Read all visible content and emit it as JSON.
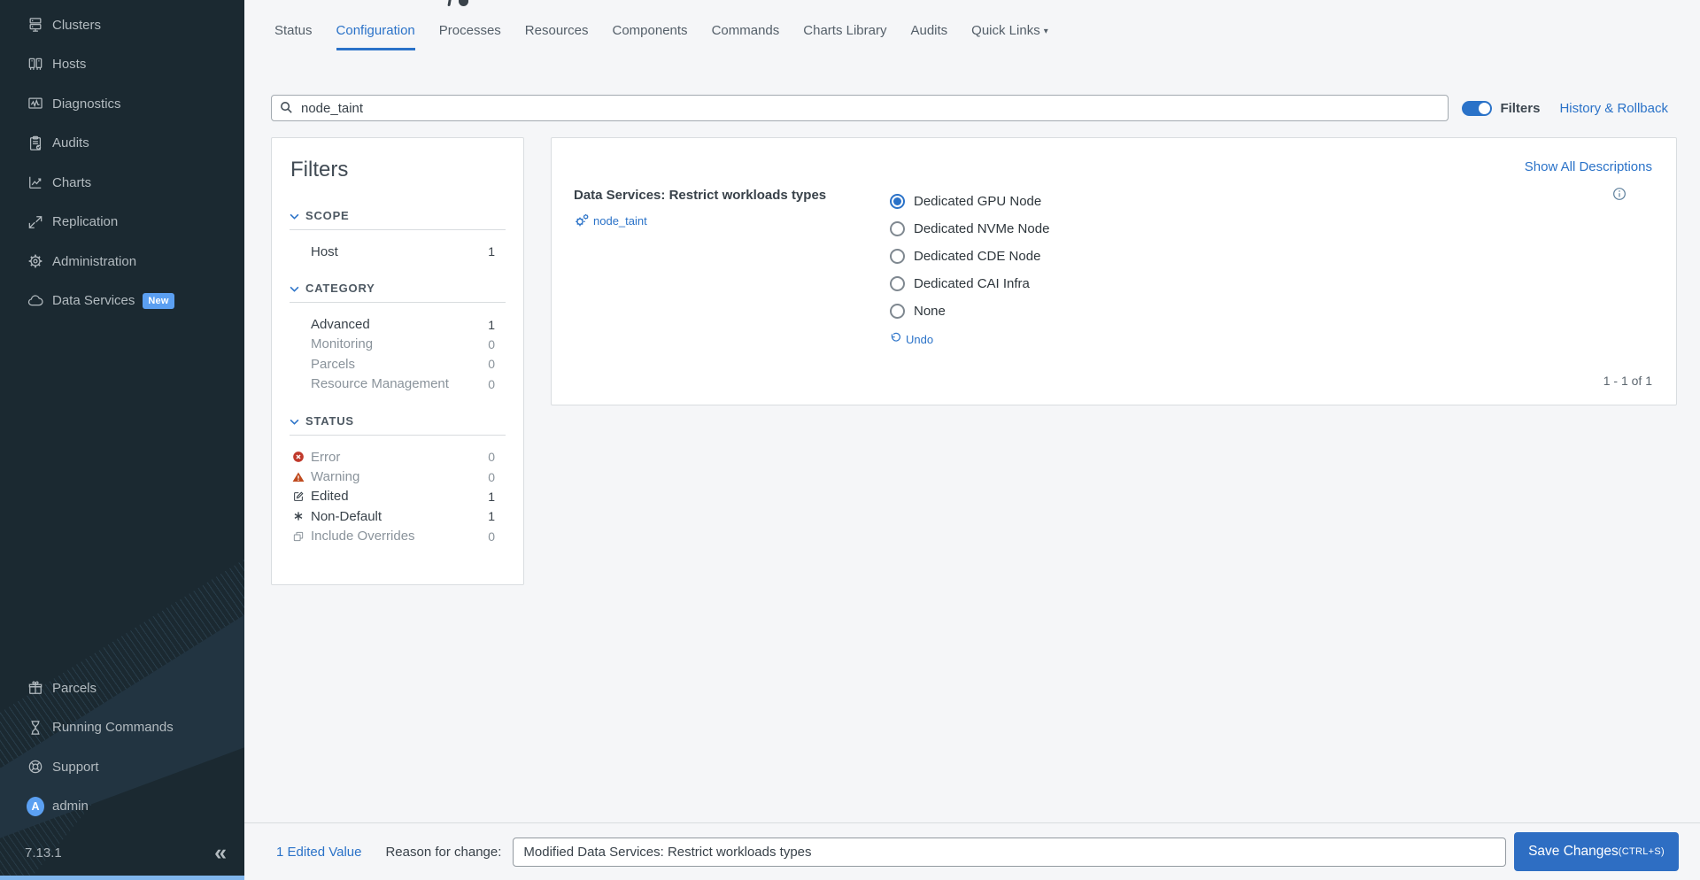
{
  "sidebar": {
    "items": [
      {
        "label": "Clusters",
        "icon": "clusters-icon"
      },
      {
        "label": "Hosts",
        "icon": "hosts-icon"
      },
      {
        "label": "Diagnostics",
        "icon": "diagnostics-icon"
      },
      {
        "label": "Audits",
        "icon": "audits-icon"
      },
      {
        "label": "Charts",
        "icon": "charts-icon"
      },
      {
        "label": "Replication",
        "icon": "replication-icon"
      },
      {
        "label": "Administration",
        "icon": "gear-icon"
      },
      {
        "label": "Data Services",
        "icon": "cloud-icon",
        "badge": "New"
      }
    ],
    "bottom_items": [
      {
        "label": "Parcels",
        "icon": "gift-icon"
      },
      {
        "label": "Running Commands",
        "icon": "hourglass-icon"
      },
      {
        "label": "Support",
        "icon": "lifebuoy-icon"
      },
      {
        "label": "admin",
        "icon": "avatar",
        "avatar_letter": "A"
      }
    ],
    "version": "7.13.1",
    "collapse_glyph": "«"
  },
  "tabs": {
    "items": [
      "Status",
      "Configuration",
      "Processes",
      "Resources",
      "Components",
      "Commands",
      "Charts Library",
      "Audits",
      "Quick Links"
    ],
    "active": "Configuration",
    "dropdown_caret": "▾"
  },
  "search": {
    "value": "node_taint",
    "icon": "search-icon"
  },
  "toolbar": {
    "filters_label": "Filters",
    "filters_toggle_on": true,
    "history_label": "History & Rollback"
  },
  "filters": {
    "title": "Filters",
    "scope": {
      "heading": "SCOPE",
      "items": [
        {
          "label": "Host",
          "count": "1"
        }
      ]
    },
    "category": {
      "heading": "CATEGORY",
      "items": [
        {
          "label": "Advanced",
          "count": "1"
        },
        {
          "label": "Monitoring",
          "count": "0"
        },
        {
          "label": "Parcels",
          "count": "0"
        },
        {
          "label": "Resource Management",
          "count": "0"
        }
      ]
    },
    "status": {
      "heading": "STATUS",
      "items": [
        {
          "label": "Error",
          "count": "0",
          "icon": "error-icon"
        },
        {
          "label": "Warning",
          "count": "0",
          "icon": "warning-icon"
        },
        {
          "label": "Edited",
          "count": "1",
          "icon": "edited-icon"
        },
        {
          "label": "Non-Default",
          "count": "1",
          "icon": "non-default-icon"
        },
        {
          "label": "Include Overrides",
          "count": "0",
          "icon": "include-overrides-icon"
        }
      ]
    }
  },
  "config": {
    "show_all_label": "Show All Descriptions",
    "info_icon": "info-icon",
    "property": {
      "name": "Data Services: Restrict workloads types",
      "tag": "node_taint",
      "tag_icon": "gears-icon"
    },
    "options": [
      {
        "label": "Dedicated GPU Node",
        "selected": true
      },
      {
        "label": "Dedicated NVMe Node",
        "selected": false
      },
      {
        "label": "Dedicated CDE Node",
        "selected": false
      },
      {
        "label": "Dedicated CAI Infra",
        "selected": false
      },
      {
        "label": "None",
        "selected": false
      }
    ],
    "undo_label": "Undo",
    "undo_icon": "undo-icon",
    "pagination": "1 - 1 of 1"
  },
  "footer": {
    "edited_label": "1 Edited Value",
    "reason_label": "Reason for change:",
    "reason_value": "Modified Data Services: Restrict workloads types",
    "save_label": "Save Changes",
    "save_shortcut": "(CTRL+S)"
  },
  "colors": {
    "accent": "#2a72c8",
    "sidebar_bg": "#1b2931",
    "save_button": "#2e6ec3",
    "badge_blue": "#5b9ff1",
    "error_red": "#c0392b",
    "warning_orange": "#bf4a1e",
    "scrollbar_blue": "#7fb5ec"
  }
}
